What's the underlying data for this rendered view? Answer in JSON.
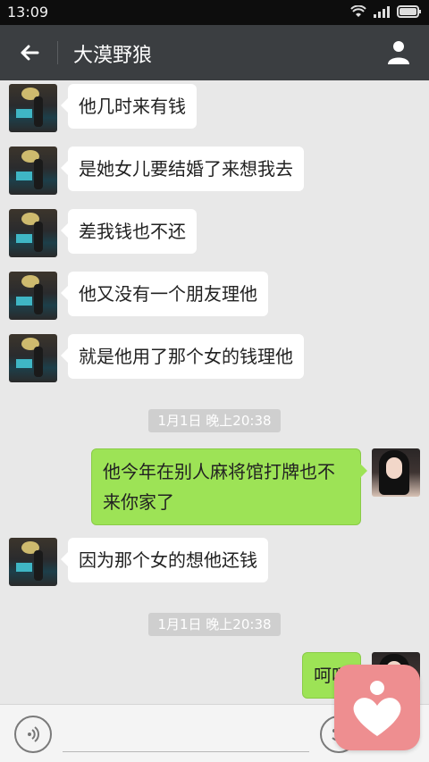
{
  "status": {
    "time": "13:09"
  },
  "nav": {
    "title": "大漠野狼",
    "back_icon": "arrow-left-icon",
    "profile_icon": "person-icon"
  },
  "messages": [
    {
      "side": "in",
      "text": "他几时来有钱"
    },
    {
      "side": "in",
      "text": "是她女儿要结婚了来想我去"
    },
    {
      "side": "in",
      "text": "差我钱也不还"
    },
    {
      "side": "in",
      "text": "他又没有一个朋友理他"
    },
    {
      "side": "in",
      "text": "就是他用了那个女的钱理他"
    },
    {
      "type": "time",
      "text": "1月1日 晚上20:38"
    },
    {
      "side": "out",
      "line1": "他今年在别人麻将馆打牌也不",
      "line2": "来你家了"
    },
    {
      "side": "in",
      "text": "因为那个女的想他还钱"
    },
    {
      "type": "time",
      "text": "1月1日 晚上20:38"
    },
    {
      "side": "out",
      "text": "呵呵"
    }
  ],
  "bottom": {
    "voice_icon": "voice-icon",
    "emoji_icon": "emoji-icon"
  },
  "floating": {
    "icon": "heart-icon",
    "color": "#ee8e90"
  }
}
